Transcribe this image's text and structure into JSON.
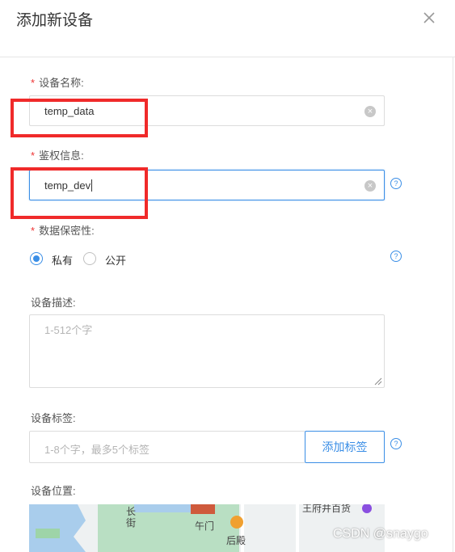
{
  "dialog": {
    "title": "添加新设备",
    "close_icon": "close-icon"
  },
  "form": {
    "required_mark": "*",
    "device_name": {
      "label": "设备名称:",
      "value": "temp_data"
    },
    "auth_info": {
      "label": "鉴权信息:",
      "value": "temp_dev",
      "help_icon": "help-circle-icon"
    },
    "privacy": {
      "label": "数据保密性:",
      "options": [
        "私有",
        "公开"
      ],
      "selected": "私有",
      "help_icon": "help-circle-icon"
    },
    "description": {
      "label": "设备描述:",
      "placeholder": "1-512个字"
    },
    "tags": {
      "label": "设备标签:",
      "placeholder": "1-8个字，最多5个标签",
      "add_button": "添加标签",
      "help_icon": "help-circle-icon"
    },
    "location": {
      "label": "设备位置:",
      "map_labels": [
        "长",
        "街",
        "午门",
        "后殿",
        "王府井百货"
      ]
    }
  },
  "watermark": "CSDN @snaygo",
  "colors": {
    "accent": "#3a8ee6",
    "required": "#e33333",
    "highlight_box": "#f02a2a"
  }
}
